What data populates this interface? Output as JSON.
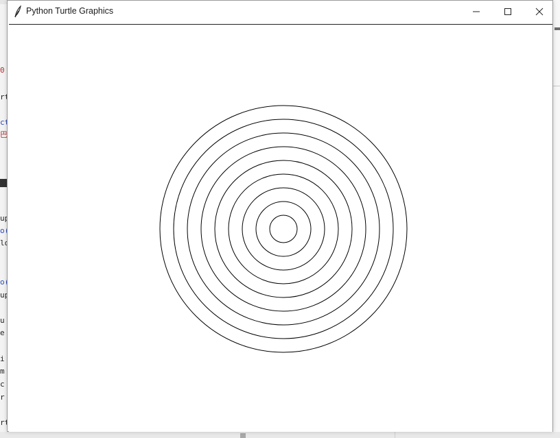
{
  "window": {
    "title": "Python Turtle Graphics",
    "icon": "feather-icon",
    "controls": {
      "minimize_icon": "minimize-icon",
      "maximize_icon": "maximize-icon",
      "close_icon": "close-icon"
    }
  },
  "canvas": {
    "background": "#ffffff",
    "stroke_color": "#000000",
    "circles": {
      "count": 9,
      "radius_step": 20,
      "center": [
        0,
        0
      ]
    }
  },
  "background_editor": {
    "code_fragments": [
      "0",
      "rt",
      "ct",
      "巴",
      "up",
      "o(",
      "lo",
      "o(",
      "up",
      "u",
      "e",
      "i",
      "m",
      "c",
      "r",
      "rt"
    ]
  }
}
